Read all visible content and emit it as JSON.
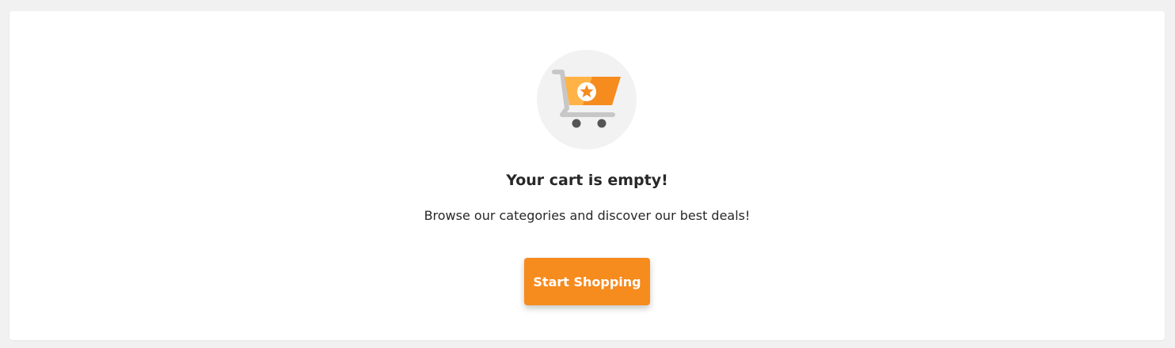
{
  "empty_cart": {
    "illustration_icon": "shopping-cart-star-icon",
    "headline": "Your cart is empty!",
    "subtext": "Browse our categories and discover our best deals!",
    "cta_label": "Start Shopping"
  },
  "colors": {
    "page_background": "#f1f1f2",
    "card_background": "#ffffff",
    "accent": "#f68b1e",
    "accent_light": "#ffb347",
    "icon_circle": "#f2f2f2",
    "cart_frame": "#c7c7c7",
    "wheels": "#555555",
    "text": "#282828"
  }
}
